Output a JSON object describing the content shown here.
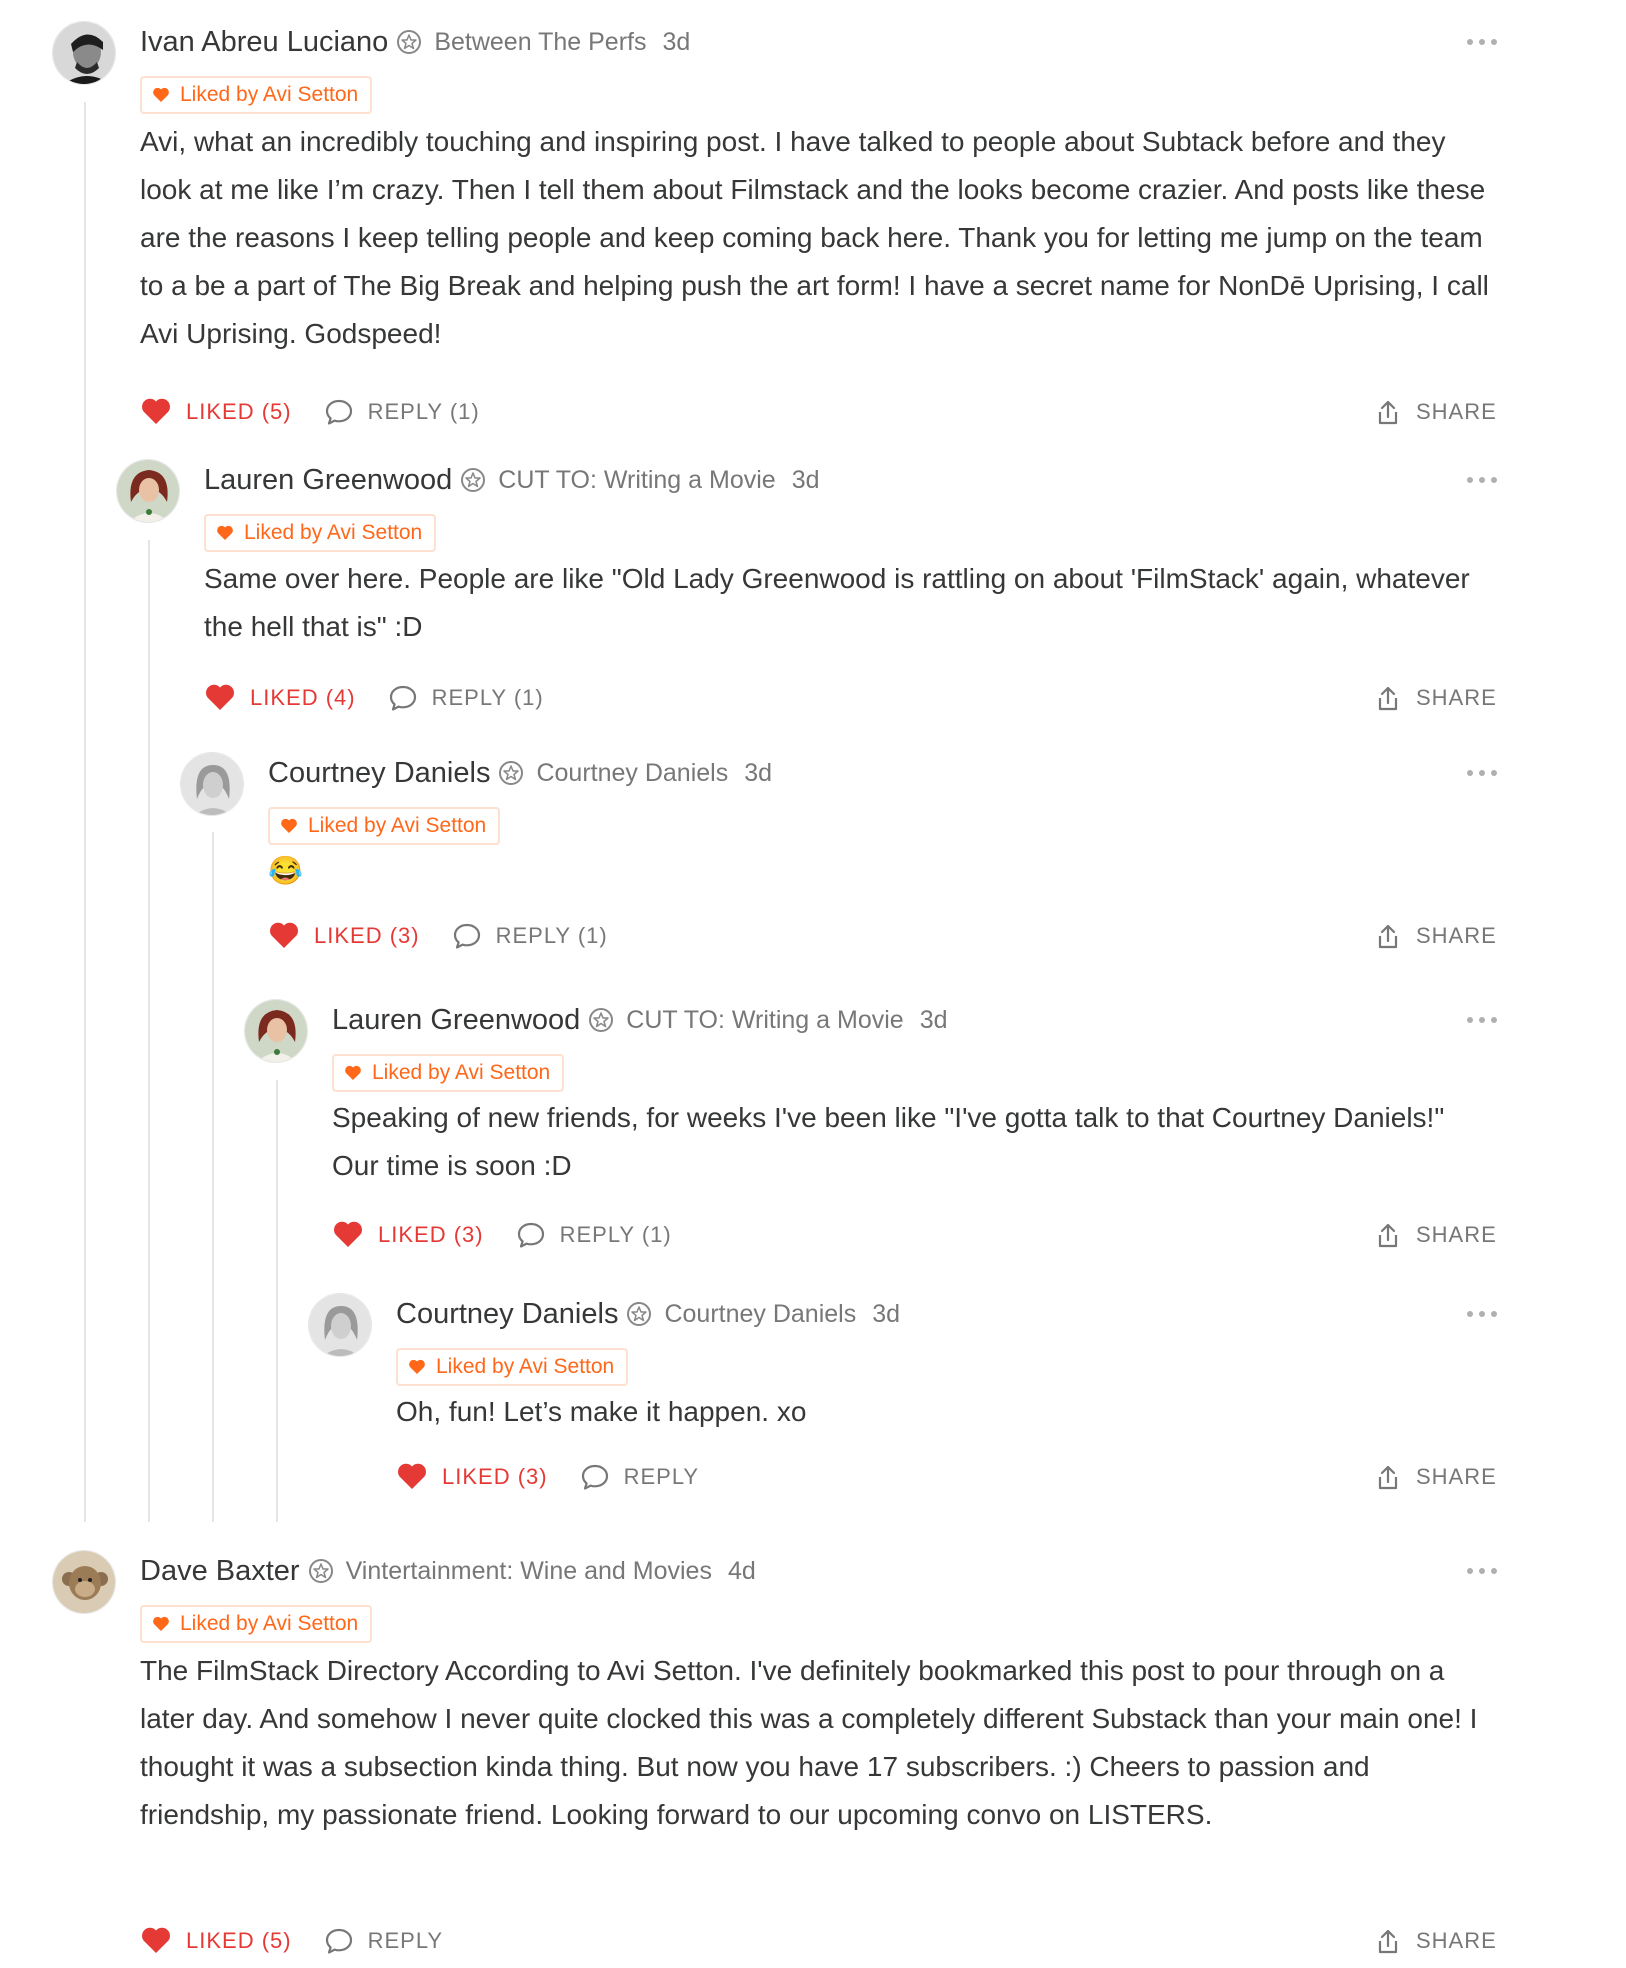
{
  "liked_by_label": "Liked by Avi Setton",
  "share_label": "SHARE",
  "colors": {
    "accent": "#ff6719",
    "liked": "#e53935",
    "muted": "#777777",
    "text": "#363737"
  },
  "comments": [
    {
      "author": "Ivan Abreu Luciano",
      "publication": "Between The Perfs",
      "age": "3d",
      "body": "Avi, what an incredibly touching and inspiring post. I have talked to people about Subtack before and they look at me like I’m crazy. Then I tell them about Filmstack and the looks become crazier. And posts like these are the reasons I keep telling people and keep coming back here. Thank you for letting me jump on the team to a be a part of The Big Break and helping push the art form! I have a secret name for NonDē Uprising, I call Avi Uprising. Godspeed!",
      "liked_label": "LIKED (5)",
      "reply_label": "REPLY (1)",
      "avatar": "man-dark-hair-avatar"
    },
    {
      "author": "Lauren Greenwood",
      "publication": "CUT TO: Writing a Movie",
      "age": "3d",
      "body": "Same over here. People are like \"Old Lady Greenwood is rattling on about 'FilmStack' again, whatever the hell that is\" :D",
      "liked_label": "LIKED (4)",
      "reply_label": "REPLY (1)",
      "avatar": "woman-red-hair-avatar"
    },
    {
      "author": "Courtney Daniels",
      "publication": "Courtney Daniels",
      "age": "3d",
      "body": "😂",
      "liked_label": "LIKED (3)",
      "reply_label": "REPLY (1)",
      "avatar": "woman-grayscale-avatar"
    },
    {
      "author": "Lauren Greenwood",
      "publication": "CUT TO: Writing a Movie",
      "age": "3d",
      "body": "Speaking of new friends, for weeks I've been like \"I've gotta talk to that Courtney Daniels!\" Our time is soon :D",
      "liked_label": "LIKED (3)",
      "reply_label": "REPLY (1)",
      "avatar": "woman-red-hair-avatar"
    },
    {
      "author": "Courtney Daniels",
      "publication": "Courtney Daniels",
      "age": "3d",
      "body": "Oh, fun! Let’s make it happen. xo",
      "liked_label": "LIKED (3)",
      "reply_label": "REPLY",
      "avatar": "woman-grayscale-avatar"
    },
    {
      "author": "Dave Baxter",
      "publication": "Vintertainment: Wine and Movies",
      "age": "4d",
      "body": "The FilmStack Directory According to Avi Setton. I've definitely bookmarked this post to pour through on a later day. And somehow I never quite clocked this was a completely different Substack than your main one! I thought it was a subsection kinda thing. But now you have 17 subscribers. :) Cheers to passion and friendship, my passionate friend. Looking forward to our upcoming convo on LISTERS.",
      "liked_label": "LIKED (5)",
      "reply_label": "REPLY",
      "avatar": "monkey-avatar"
    }
  ]
}
